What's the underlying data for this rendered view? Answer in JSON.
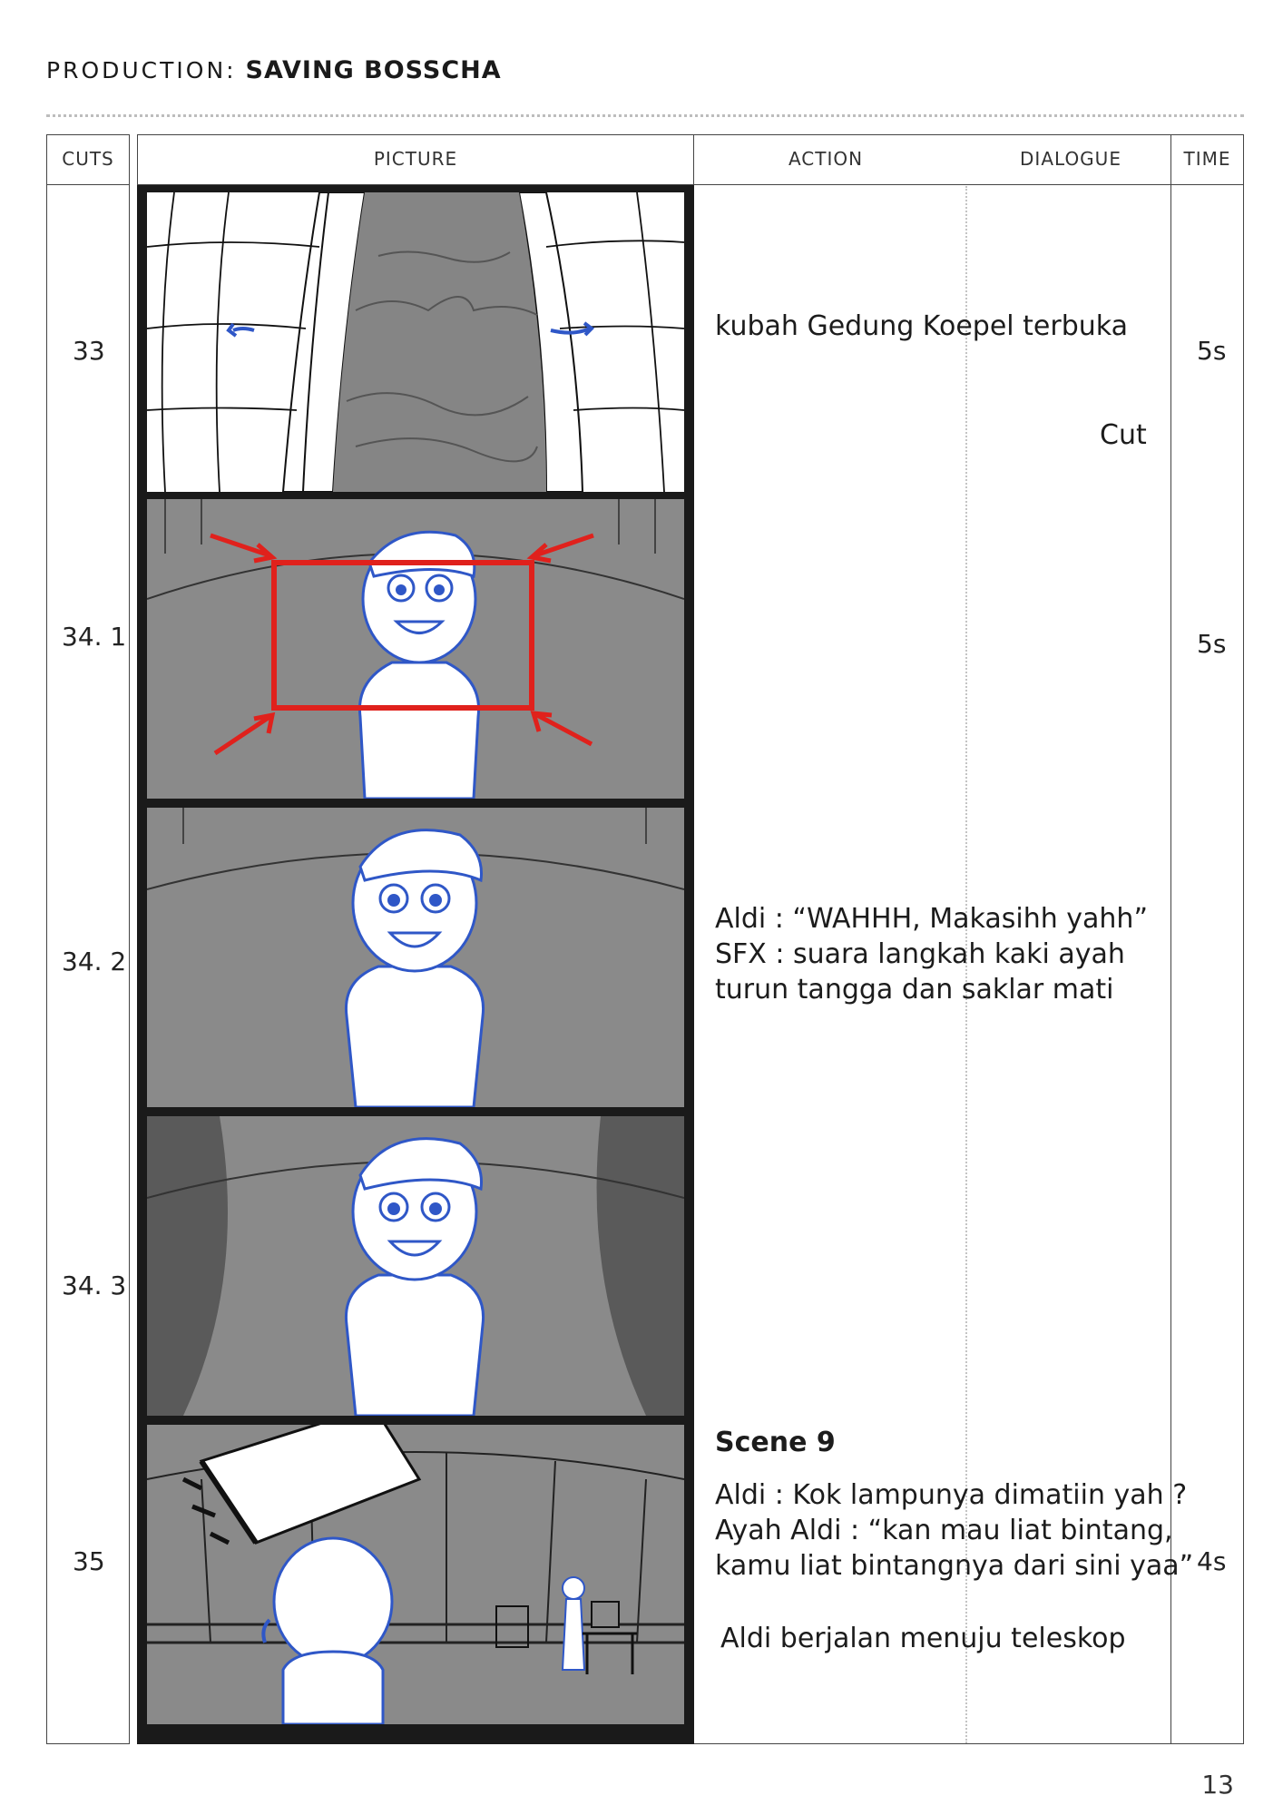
{
  "header": {
    "label": "PRODUCTION:",
    "title": "SAVING BOSSCHA"
  },
  "columns": {
    "cuts": "CUTS",
    "picture": "PICTURE",
    "action": "ACTION",
    "dialogue": "DIALOGUE",
    "time": "TIME"
  },
  "rows": [
    {
      "cut": "33",
      "time": "5s"
    },
    {
      "cut": "34. 1",
      "time": "5s"
    },
    {
      "cut": "34. 2"
    },
    {
      "cut": "34. 3"
    },
    {
      "cut": "35",
      "time": "4s"
    }
  ],
  "notes": {
    "n33": "kubah Gedung Koepel terbuka",
    "cut": "Cut",
    "n342_1": "Aldi : “WAHHH, Makasihh yahh”",
    "n342_2": "SFX : suara langkah kaki ayah",
    "n342_3": "turun tangga dan saklar mati",
    "scene": "Scene 9",
    "n35_1": "Aldi : Kok lampunya dimatiin yah ?",
    "n35_2": "Ayah Aldi : “kan mau liat bintang,",
    "n35_3": "kamu liat bintangnya dari sini yaa”",
    "n35_4": "Aldi berjalan menuju teleskop"
  },
  "page_number": "13",
  "colors": {
    "sketch_blue": "#2f57c7",
    "arrow_red": "#e0211c",
    "panel_gray": "#8a8a8a"
  }
}
